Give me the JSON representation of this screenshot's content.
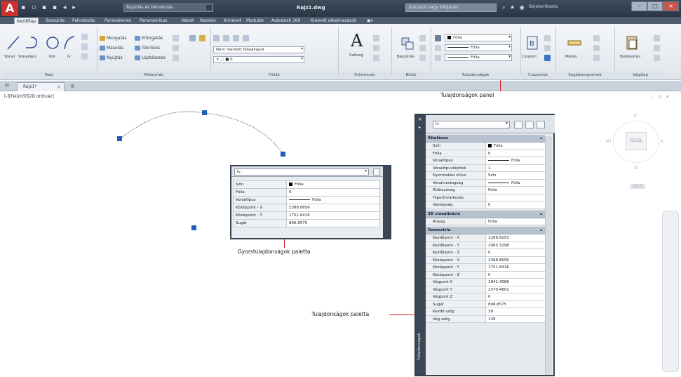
{
  "titlebar": {
    "app_letter": "A",
    "workspace": "Rajzolás és feliratozás",
    "document_title": "Rajz1.dwg",
    "search_placeholder": "Kulcsszó vagy kifejezés",
    "sign_in": "Bejelentkezés"
  },
  "tabs": [
    "Kezdőlap",
    "Beszúrás",
    "Feliratozás",
    "Paraméteres",
    "Parametrikus",
    "Nézet",
    "Kezelés",
    "Kimenet",
    "Modulok",
    "Autodesk 360",
    "Kiemelt alkalmazások"
  ],
  "ribbon": {
    "draw": {
      "line": "Vonal",
      "polyline": "Vonallánc",
      "circle": "Kör",
      "arc": "Ív",
      "panel": "Rajz"
    },
    "modify": {
      "move": "Mozgatás",
      "rotate": "Elforgatás",
      "copy": "Másolás",
      "mirror": "Tükrözés",
      "stretch": "Nyújtás",
      "scale": "Léptékezés",
      "panel": "Módosítás"
    },
    "layers": {
      "layer_state": "Nem mentett fóliaállapot",
      "layer_value": "0",
      "panel": "Fóliák"
    },
    "annotation": {
      "text": "Szöveg",
      "panel": "Feliratozás"
    },
    "block": {
      "insert": "Beszúrás",
      "panel": "Blokk"
    },
    "properties": {
      "color": "Fólia",
      "linetype": "Fólia",
      "lineweight": "Fólia",
      "panel": "Tulajdonságok"
    },
    "groups": {
      "group": "Csoport",
      "panel": "Csoportok"
    },
    "utilities": {
      "measure": "Mérés",
      "panel": "Segédprogramok"
    },
    "clipboard": {
      "paste": "Beillesztés",
      "panel": "Vágólap"
    }
  },
  "file_tab": "Rajz1*",
  "viewport_label": "[-][Felülről][2D drótváz]",
  "viewcube": {
    "face": "FELÜL",
    "north": "É",
    "south": "D",
    "west": "NY",
    "east": "K",
    "ucs": "WCS"
  },
  "quick_props": {
    "object_type": "Ív",
    "rows": [
      {
        "k": "Szín",
        "v": "Fólia"
      },
      {
        "k": "Fólia",
        "v": "0"
      },
      {
        "k": "Vonaltípus",
        "v": "Fólia"
      },
      {
        "k": "Középpont - X",
        "v": "2388.8656"
      },
      {
        "k": "Középpont - Y",
        "v": "1751.8416"
      },
      {
        "k": "Sugár",
        "v": "806.6575"
      }
    ]
  },
  "properties_palette": {
    "object_type": "Ív",
    "strip_label": "Tulajdonságok",
    "sections": [
      {
        "title": "Általános",
        "rows": [
          {
            "k": "Szín",
            "v": "Fólia"
          },
          {
            "k": "Fólia",
            "v": "0"
          },
          {
            "k": "Vonaltípus",
            "v": "Fólia"
          },
          {
            "k": "Vonaltípusléptték",
            "v": "1"
          },
          {
            "k": "Nyomtatási stílus",
            "v": "Szín"
          },
          {
            "k": "Vonalvastagság",
            "v": "Fólia"
          },
          {
            "k": "Átlátszóság",
            "v": "Fólia"
          },
          {
            "k": "Hiperhivatkozás",
            "v": ""
          },
          {
            "k": "Vastagság",
            "v": "0"
          }
        ]
      },
      {
        "title": "3D vizualizáció",
        "rows": [
          {
            "k": "Anyag",
            "v": "Fólia"
          }
        ]
      },
      {
        "title": "Geometria",
        "rows": [
          {
            "k": "Kezdőpont - X",
            "v": "2289.8253"
          },
          {
            "k": "Kezdőpont - Y",
            "v": "2063.3298"
          },
          {
            "k": "Kezdőpont - Z",
            "v": "0"
          },
          {
            "k": "Középpont - X",
            "v": "2388.8656"
          },
          {
            "k": "Középpont - Y",
            "v": "1751.8416"
          },
          {
            "k": "Középpont - Z",
            "v": "0"
          },
          {
            "k": "Végpont X",
            "v": "1841.4586"
          },
          {
            "k": "Végpont Y",
            "v": "2370.4802"
          },
          {
            "k": "Végpont Z",
            "v": "0"
          },
          {
            "k": "Sugár",
            "v": "806.6575"
          },
          {
            "k": "Kezdő szög",
            "v": "38"
          },
          {
            "k": "Vég szög",
            "v": "128"
          }
        ]
      }
    ]
  },
  "callouts": {
    "ribbon_panel": "Tulajdonságok panel",
    "quick_props": "Gyorstulajdonságok paletta",
    "properties_palette": "Tulajdonságok paletta"
  },
  "colors": {
    "grip": "#1f5fb3",
    "callout_line": "#cc1b1b",
    "titlebar": "#2b3644"
  }
}
